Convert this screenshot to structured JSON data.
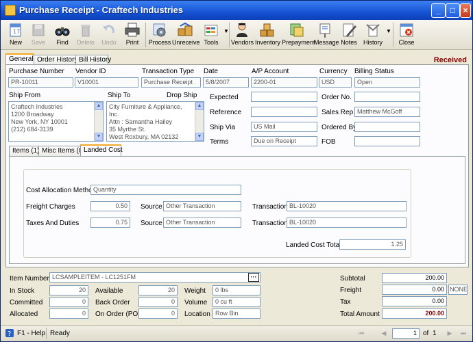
{
  "window": {
    "title": "Purchase Receipt - Craftech Industries",
    "min": "_",
    "max": "□",
    "close": "×"
  },
  "toolbar": {
    "buttons": [
      {
        "label": "New",
        "icon": "new-document-icon",
        "enabled": true
      },
      {
        "label": "Save",
        "icon": "save-icon",
        "enabled": false
      },
      {
        "label": "Find",
        "icon": "binoculars-icon",
        "enabled": true
      },
      {
        "label": "Delete",
        "icon": "trash-icon",
        "enabled": false
      },
      {
        "label": "Undo",
        "icon": "undo-icon",
        "enabled": false
      },
      {
        "label": "Print",
        "icon": "printer-icon",
        "enabled": true
      },
      {
        "label": "Process",
        "icon": "gear-icon",
        "enabled": true
      },
      {
        "label": "Unreceive",
        "icon": "boxes-icon",
        "enabled": true
      },
      {
        "label": "Tools",
        "icon": "tools-icon",
        "enabled": true
      },
      {
        "label": "Vendors",
        "icon": "vendor-person-icon",
        "enabled": true
      },
      {
        "label": "Inventory",
        "icon": "inventory-boxes-icon",
        "enabled": true
      },
      {
        "label": "Prepayment",
        "icon": "prepayment-icon",
        "enabled": true
      },
      {
        "label": "Message",
        "icon": "message-board-icon",
        "enabled": true
      },
      {
        "label": "Notes",
        "icon": "notes-pencil-icon",
        "enabled": true
      },
      {
        "label": "History",
        "icon": "history-icon",
        "enabled": true
      },
      {
        "label": "Close",
        "icon": "close-window-icon",
        "enabled": true
      }
    ]
  },
  "tabs": [
    "General",
    "Order History",
    "Bill History"
  ],
  "status_label": "Received",
  "header": {
    "purchase_number_label": "Purchase Number",
    "purchase_number": "PR-10011",
    "vendor_id_label": "Vendor ID",
    "vendor_id": "V10001",
    "transaction_type_label": "Transaction Type",
    "transaction_type": "Purchase Receipt",
    "date_label": "Date",
    "date": "5/8/2007",
    "ap_account_label": "A/P Account",
    "ap_account": "2200-01",
    "currency_label": "Currency",
    "currency": "USD",
    "billing_status_label": "Billing Status",
    "billing_status": "Open"
  },
  "addresses": {
    "ship_from_label": "Ship From",
    "ship_from": [
      "Craftech Industries",
      "1200 Broadway",
      "New York, NY 10001",
      "(212) 684-3139"
    ],
    "ship_to_label": "Ship To",
    "drop_ship_label": "Drop Ship",
    "ship_to": [
      "City Furniture & Appliance,",
      "Inc.",
      "Attn : Samantha Hailey",
      "35 Myrthe St.",
      "West Roxbury, MA 02132"
    ]
  },
  "details": {
    "expected_label": "Expected",
    "expected": "",
    "reference_label": "Reference",
    "reference": "",
    "ship_via_label": "Ship Via",
    "ship_via": "US Mail",
    "terms_label": "Terms",
    "terms": "Due on Receipt",
    "order_no_label": "Order No.",
    "order_no": "",
    "sales_rep_label": "Sales Rep",
    "sales_rep": "Matthew McGoff",
    "ordered_by_label": "Ordered By",
    "ordered_by": "",
    "fob_label": "FOB",
    "fob": ""
  },
  "subtabs": [
    "Items (1)",
    "Misc Items (0)",
    "Landed Cost"
  ],
  "landed_cost": {
    "allocation_method_label": "Cost Allocation Method",
    "allocation_method": "Quantity",
    "freight_label": "Freight Charges",
    "freight": "0.50",
    "freight_source_label": "Source",
    "freight_source": "Other Transaction",
    "freight_txn_label": "Transaction",
    "freight_txn": "BL-10020",
    "taxes_label": "Taxes And Duties",
    "taxes": "0.75",
    "taxes_source_label": "Source",
    "taxes_source": "Other Transaction",
    "taxes_txn_label": "Transaction",
    "taxes_txn": "BL-10020",
    "total_label": "Landed Cost Total",
    "total": "1.25"
  },
  "item": {
    "item_number_label": "Item Number",
    "item_number": "LCSAMPLEITEM - LC1251FM",
    "lookup": "···",
    "in_stock_label": "In Stock",
    "in_stock": "20",
    "available_label": "Available",
    "available": "20",
    "weight_label": "Weight",
    "weight": "0 lbs",
    "committed_label": "Committed",
    "committed": "0",
    "back_order_label": "Back Order",
    "back_order": "0",
    "volume_label": "Volume",
    "volume": "0 cu ft",
    "allocated_label": "Allocated",
    "allocated": "0",
    "on_order_label": "On Order (PO)",
    "on_order": "0",
    "location_label": "Location",
    "location": "Row Bin"
  },
  "totals": {
    "subtotal_label": "Subtotal",
    "subtotal": "200.00",
    "freight_label": "Freight",
    "freight": "0.00",
    "freight_tax_code": "NONE",
    "tax_label": "Tax",
    "tax": "0.00",
    "total_label": "Total Amount",
    "total": "200.00"
  },
  "statusbar": {
    "help": "F1 - Help",
    "status": "Ready",
    "page": "1",
    "of_label": "of",
    "page_count": "1"
  },
  "colors": {
    "accent": "#1553d4",
    "received": "#8b0000",
    "tab_highlight": "#f5a823"
  }
}
